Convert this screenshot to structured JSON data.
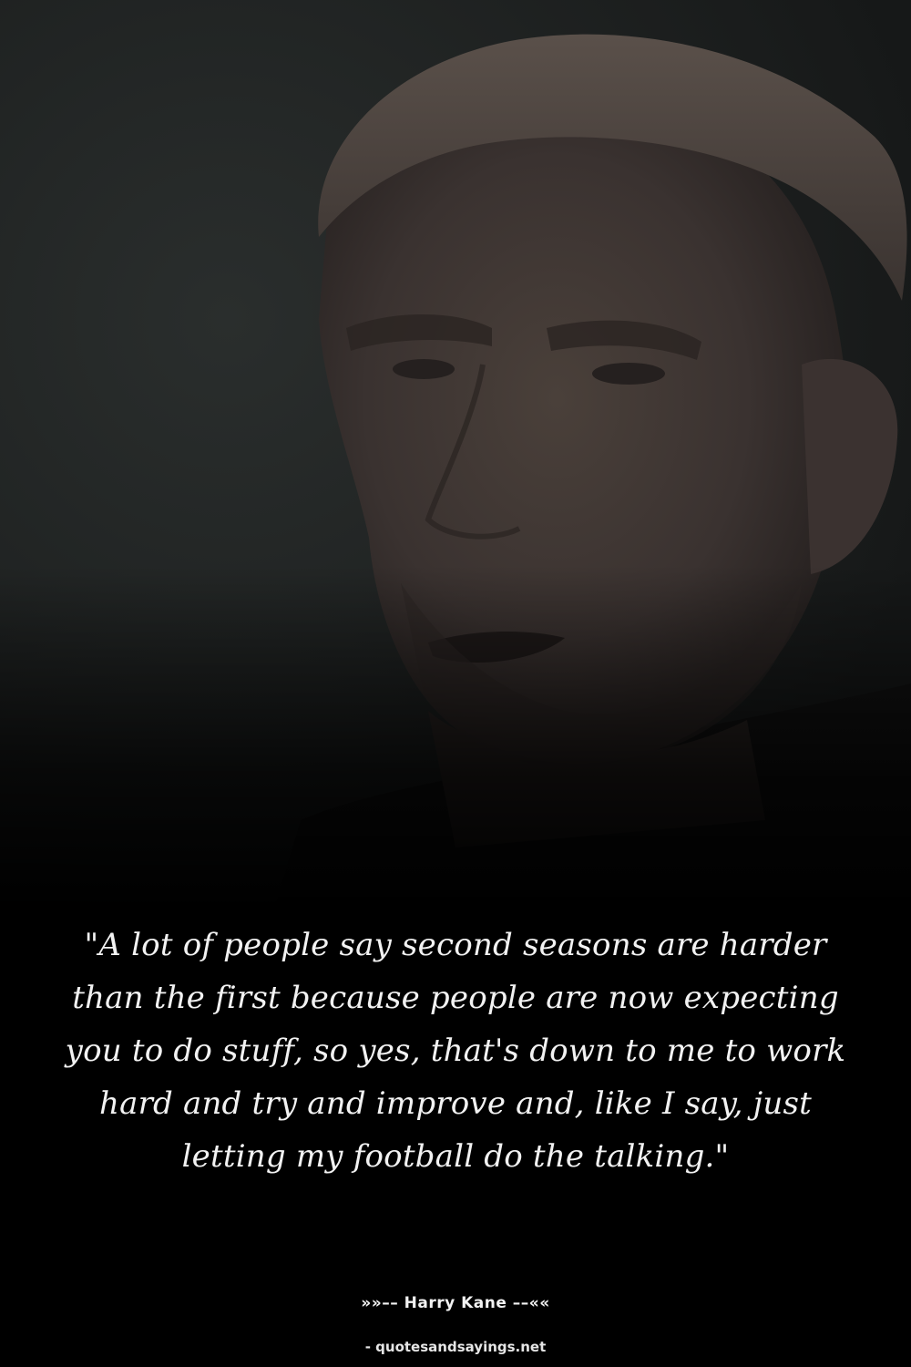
{
  "photo": {
    "subject": "portrait-photo",
    "background_color": "#1e2120"
  },
  "quote": {
    "text": "\"A lot of people say second seasons are harder than the first because people are now expecting you to do stuff, so yes, that's down to me to work hard and try and improve and, like I say, just letting my football do the talking.\""
  },
  "attribution": {
    "prefix": "»»–– ",
    "author": "Harry Kane",
    "suffix": " ––««"
  },
  "credit": {
    "text": "- quotesandsayings.net"
  },
  "colors": {
    "text": "#f2f2f2",
    "background": "#000000"
  }
}
